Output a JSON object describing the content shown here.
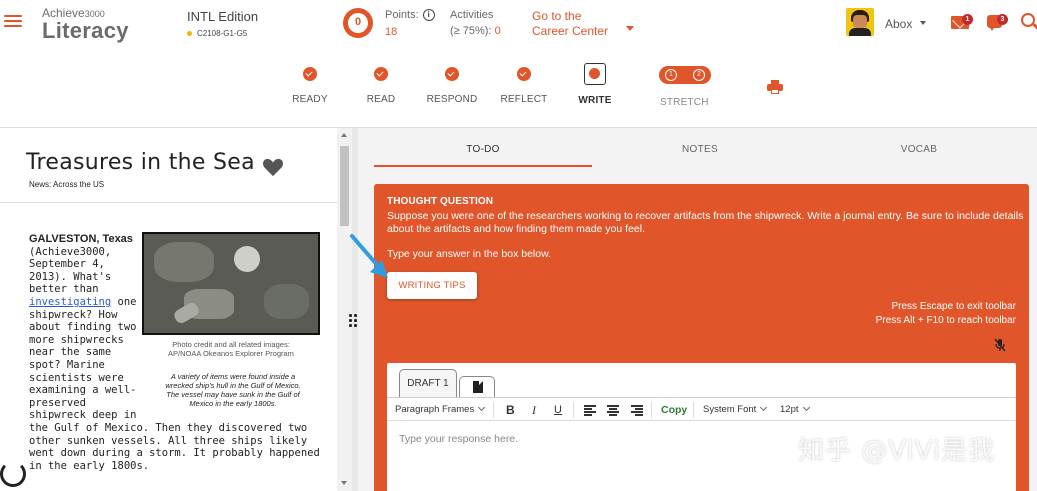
{
  "header": {
    "brand_line1": "Achieve",
    "brand_line1_small": "3000",
    "brand_line2": "Literacy",
    "edition": "INTL Edition",
    "class_code": "C2108-G1-G5",
    "points_badge": "0",
    "points_label": "Points:",
    "points_value": "18",
    "activities_label": "Activities",
    "activities_sub": "(≥ 75%):",
    "activities_value": "0",
    "career_line1": "Go to the",
    "career_line2": "Career Center",
    "user_name": "Abox",
    "mail_count": "1",
    "messages_count": "3"
  },
  "stepper": {
    "steps": [
      {
        "label": "READY",
        "state": "done"
      },
      {
        "label": "READ",
        "state": "done"
      },
      {
        "label": "RESPOND",
        "state": "done"
      },
      {
        "label": "REFLECT",
        "state": "done"
      },
      {
        "label": "WRITE",
        "state": "current"
      }
    ],
    "stretch_label": "STRETCH",
    "stretch_items": [
      "1",
      "2"
    ]
  },
  "article": {
    "title": "Treasures in the Sea",
    "subtitle": "News: Across the US",
    "place": "GALVESTON, Texas",
    "body_narrow_1": "(Achieve3000, September 4, 2013). What's better than",
    "link": "investigating",
    "body_narrow_2": "one shipwreck? How about finding two more shipwrecks near the same spot? Marine scientists were examining a well-preserved shipwreck deep in",
    "body_wide": "the Gulf of Mexico. Then they discovered two other sunken vessels. All three ships likely went down during a storm. It probably happened in the early 1800s.",
    "photo_credit": "Photo credit and all related images: AP/NOAA Okeanos Explorer Program",
    "photo_caption": "A variety of items were found inside a wrecked ship's hull in the Gulf of Mexico. The vessel may have sunk in the Gulf of Mexico in the early 1800s."
  },
  "panel": {
    "tabs": [
      "TO-DO",
      "NOTES",
      "VOCAB"
    ],
    "active_tab": "TO-DO",
    "tq_title": "THOUGHT QUESTION",
    "tq_text": "Suppose you were one of the researchers working to recover artifacts from the shipwreck. Write a journal entry. Be sure to include details about the artifacts and how finding them made you feel.",
    "tq_instruction": "Type your answer in the box below.",
    "tips_button": "WRITING TIPS",
    "esc_note_1": "Press Escape to exit toolbar",
    "esc_note_2": "Press Alt + F10 to reach toolbar",
    "draft_tab": "DRAFT 1",
    "toolbar": {
      "paragraph": "Paragraph Frames",
      "bold": "B",
      "italic": "I",
      "underline": "U",
      "copy": "Copy",
      "font": "System Font",
      "size": "12pt"
    },
    "placeholder": "Type your response here."
  },
  "watermark": "知乎 @ViVi是我",
  "colors": {
    "accent": "#e0562a",
    "copy_green": "#2e7d32",
    "link_blue": "#2a5ccf",
    "annotation_blue": "#2f9be0"
  }
}
